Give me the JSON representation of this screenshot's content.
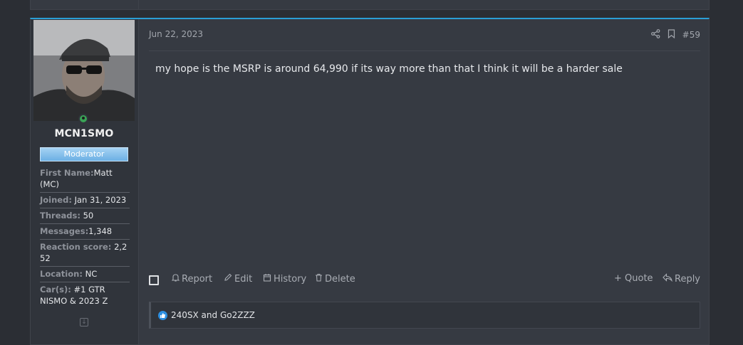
{
  "post": {
    "date": "Jun 22, 2023",
    "number": "#59",
    "body": "my hope is the MSRP is around 64,990 if its way more than that I think it will be a harder sale"
  },
  "user": {
    "name": "MCN1SMO",
    "role": "Moderator",
    "info": [
      {
        "key": "First Name:",
        "value": "Matt (MC)"
      },
      {
        "key": "Joined:",
        "value": "Jan 31, 2023"
      },
      {
        "key": "Threads:",
        "value": "50"
      },
      {
        "key": "Messages:",
        "value": "1,348"
      },
      {
        "key": "Reaction score:",
        "value": "2,252"
      },
      {
        "key": "Location:",
        "value": "NC"
      },
      {
        "key": "Car(s):",
        "value": "#1 GTR NISMO & 2023 Z"
      }
    ]
  },
  "actions": {
    "report": "Report",
    "edit": "Edit",
    "history": "History",
    "delete": "Delete",
    "quote": "+ Quote",
    "reply": "Reply"
  },
  "reactions": {
    "text": "240SX and Go2ZZZ"
  },
  "colors": {
    "accent": "#2a9fd6",
    "online": "#3aa356",
    "moderator_badge": "#6cb0e4",
    "like": "#2d8fe0"
  },
  "icons": [
    "share-icon",
    "bookmark-icon",
    "bell-icon",
    "pencil-icon",
    "calendar-icon",
    "trash-icon",
    "reply-icon",
    "thumbs-up-icon",
    "expand-icon"
  ]
}
